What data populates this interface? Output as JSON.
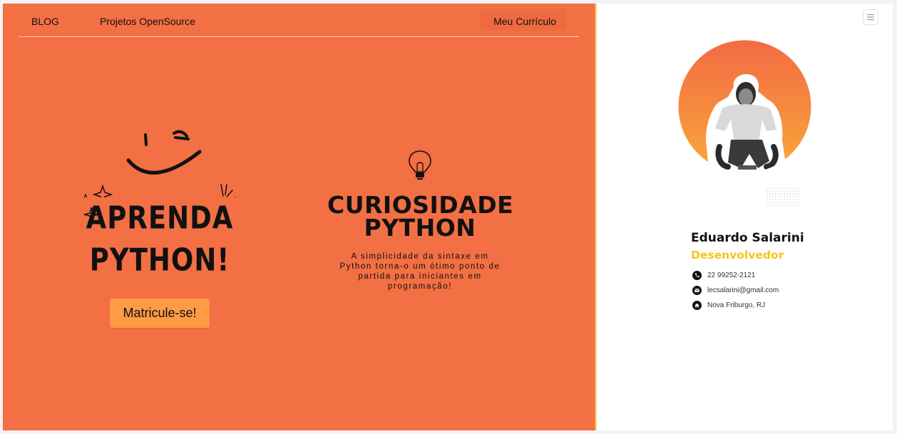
{
  "nav": {
    "blog": "BLOG",
    "projects": "Projetos OpenSource",
    "resume": "Meu Currículo"
  },
  "hero": {
    "line1": "APRENDA",
    "line2": "PYTHON!",
    "cta": "Matricule-se!"
  },
  "curiosity": {
    "title_line1": "CURIOSIDADE",
    "title_line2": "PYTHON",
    "body": "A simplicidade da sintaxe em Python torna-o um ótimo ponto de partida para iniciantes em programação!"
  },
  "profile": {
    "name": "Eduardo Salarini",
    "role": "Desenvolvedor",
    "phone": "22 99252-2121",
    "email": "lecsalarini@gmail.com",
    "location": "Nova Friburgo, RJ"
  },
  "icons": {
    "menu": "hamburger-menu-icon",
    "phone": "phone-icon",
    "email": "email-icon",
    "location": "home-icon",
    "bulb": "lightbulb-icon"
  },
  "colors": {
    "primary": "#f36f44",
    "button": "#ff9a45",
    "accent": "#f8c319",
    "divider": "#f6b12c"
  }
}
